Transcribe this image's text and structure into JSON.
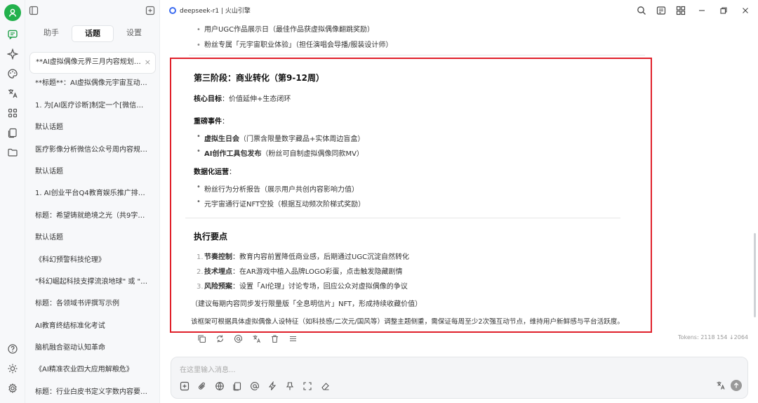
{
  "window": {
    "app_title": "deepseek-r1 | 火山引擎"
  },
  "sidebar": {
    "tabs": [
      "助手",
      "话题",
      "设置"
    ],
    "active_tab": "话题",
    "conversations": [
      "**AI虚拟偶像元界三月内容规划框架*...",
      "**标题**：AI虚拟偶像元宇宙互动季 -...",
      "1. 为[AI医疗诊断]制定一个[微信社群]...",
      "默认话题",
      "医疗影像分析微信公众号周内容规划 ...",
      "默认话题",
      "1. AI创业平台Q4教育娱乐推广排期规...",
      "标题：希望铸就绝境之光（共9字符）...",
      "默认话题",
      "《科幻预警科技伦理》",
      "\"科幻崛起科技支撑流浪地球\" 或 \"科...",
      "标题：各领域书评撰写示例",
      "AI教育终结标准化考试",
      "脑机融合驱动认知革命",
      "《AI精准农业四大应用解粮危》",
      "标题：行业白皮书定义字数内容要求 ..."
    ]
  },
  "content": {
    "prev_bullets": [
      "用户UGC作品展示日（最佳作品获虚拟偶像翻跳奖励）",
      "粉丝专属「元宇宙职业体验」（担任演唱会导播/服装设计师）"
    ],
    "phase3": {
      "title": "第三阶段：商业转化（第9-12周）",
      "core_label": "核心目标",
      "core_text": "：价值延伸+生态闭环",
      "events_label": "重磅事件",
      "events": [
        {
          "label": "虚拟生日会",
          "text": "（门票含限量数字藏品+实体周边盲盒）"
        },
        {
          "label": "AI创作工具包发布",
          "text": "（粉丝可自制虚拟偶像同款MV）"
        }
      ],
      "ops_label": "数据化运营",
      "ops": [
        "粉丝行为分析报告（展示用户共创内容影响力值）",
        "元宇宙通行证NFT空投（根据互动频次阶梯式奖励）"
      ]
    },
    "execution": {
      "title": "执行要点",
      "items": [
        {
          "n": "1.",
          "label": "节奏控制",
          "text": "：教育内容前置降低商业感，后期通过UGC沉淀自然转化"
        },
        {
          "n": "2.",
          "label": "技术埋点",
          "text": "：在AR游戏中植入品牌LOGO彩蛋，点击触发隐藏剧情"
        },
        {
          "n": "3.",
          "label": "风险预案",
          "text": "：设置「AI伦理」讨论专场，回应公众对虚拟偶像的争议"
        }
      ],
      "suggestion": "（建议每期内容同步发行限量版「全息明信片」NFT，形成持续收藏价值）",
      "summary": "该框架可根据具体虚拟偶像人设特征（如科技感/二次元/国风等）调整主题侧重，需保证每周至少2次强互动节点，维持用户新鲜感与平台活跃度。"
    },
    "tokens": "Tokens: 2118 154 ↓2064"
  },
  "input": {
    "placeholder": "在这里输入消息..."
  },
  "colors": {
    "highlight_border": "#e0202a",
    "avatar": "#22b14c",
    "logo": "#3c6cf0"
  }
}
